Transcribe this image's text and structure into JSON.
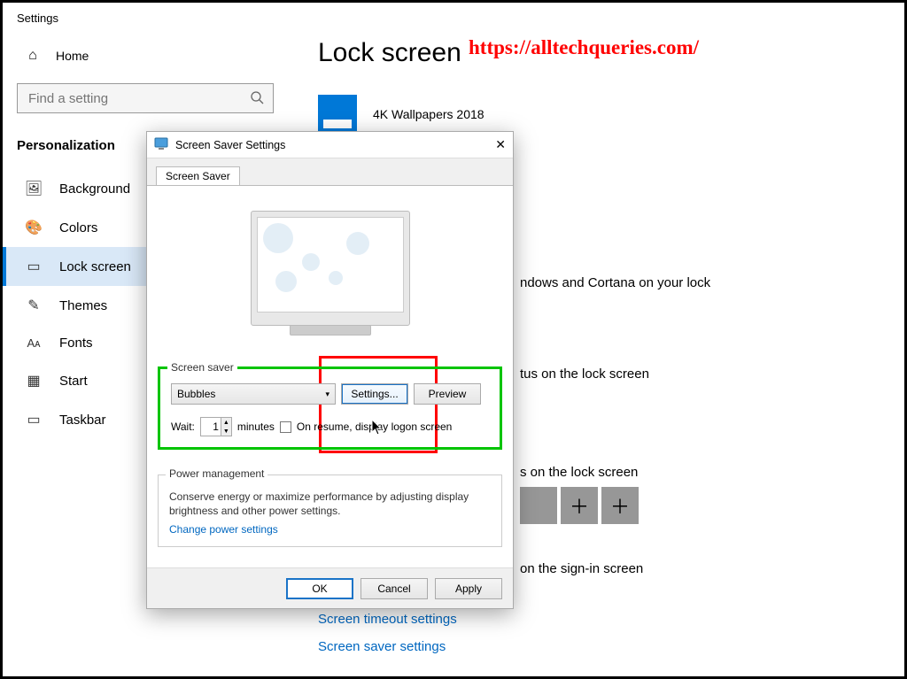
{
  "app_title": "Settings",
  "home_label": "Home",
  "search_placeholder": "Find a setting",
  "section": "Personalization",
  "nav": {
    "background": "Background",
    "colors": "Colors",
    "lock_screen": "Lock screen",
    "themes": "Themes",
    "fonts": "Fonts",
    "start": "Start",
    "taskbar": "Taskbar"
  },
  "main": {
    "heading": "Lock screen",
    "app_name": "4K Wallpapers 2018",
    "bg_line1": "ndows and Cortana on your lock",
    "bg_line2": "tus on the lock screen",
    "bg_line3": "s on the lock screen",
    "bg_line4": "on the sign-in screen",
    "link1": "Screen timeout settings",
    "link2": "Screen saver settings"
  },
  "watermark": "https://alltechqueries.com/",
  "dialog": {
    "title": "Screen Saver Settings",
    "tab": "Screen Saver",
    "group_saver": "Screen saver",
    "combo_value": "Bubbles",
    "btn_settings": "Settings...",
    "btn_preview": "Preview",
    "wait_label": "Wait:",
    "wait_value": "1",
    "minutes_label": "minutes",
    "resume_label": "On resume, display logon screen",
    "group_power": "Power management",
    "power_text": "Conserve energy or maximize performance by adjusting display brightness and other power settings.",
    "power_link": "Change power settings",
    "ok": "OK",
    "cancel": "Cancel",
    "apply": "Apply"
  }
}
